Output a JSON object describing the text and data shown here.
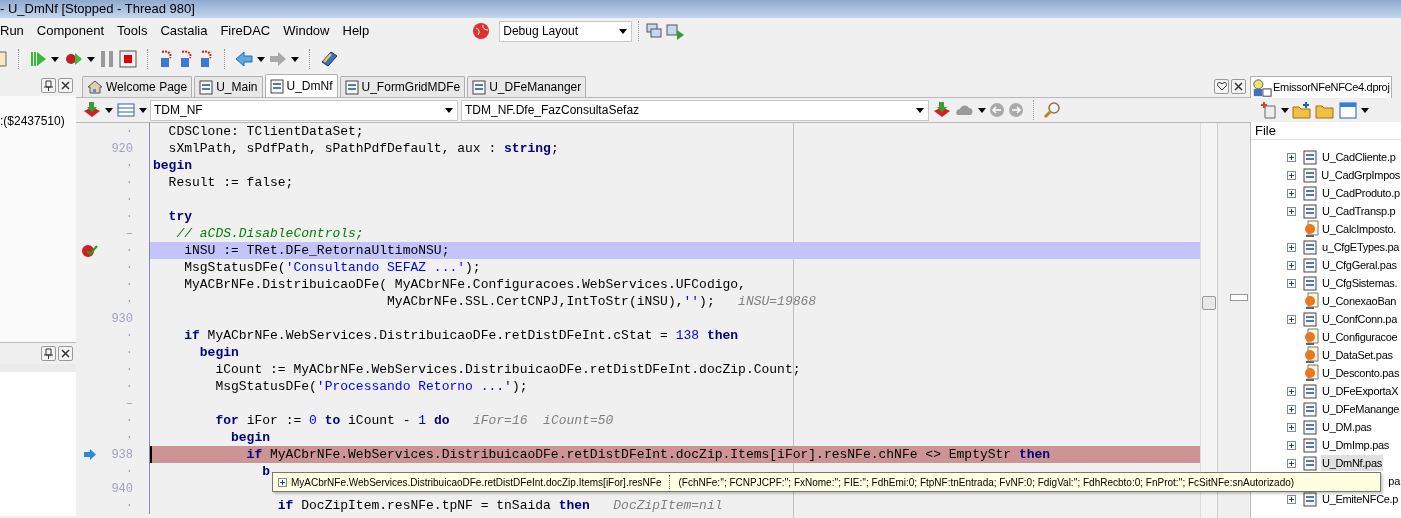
{
  "window": {
    "title": "- U_DmNf [Stopped - Thread 980]"
  },
  "menu": [
    "Run",
    "Component",
    "Tools",
    "Castalia",
    "FireDAC",
    "Window",
    "Help"
  ],
  "layout_combo": {
    "value": "Debug Layout"
  },
  "left_panel": {
    "text": ":($2437510)"
  },
  "editor_tabs": [
    {
      "label": "Welcome Page",
      "kind": "home",
      "selected": false
    },
    {
      "label": "U_Main",
      "kind": "unit",
      "selected": false
    },
    {
      "label": "U_DmNf",
      "kind": "unit",
      "selected": true
    },
    {
      "label": "U_FormGridMDFe",
      "kind": "unit",
      "selected": false
    },
    {
      "label": "U_DFeMananger",
      "kind": "unit",
      "selected": false
    }
  ],
  "unit_combo": {
    "value": "TDM_NF"
  },
  "method_combo": {
    "value": "TDM_NF.Dfe_FazConsultaSefaz"
  },
  "code_lines": [
    {
      "gutter": "·",
      "breakpoint": false,
      "current": false,
      "segments": [
        {
          "kind": "plain",
          "text": "  CDSClone: TClientDataSet;"
        }
      ]
    },
    {
      "gutter": "920",
      "breakpoint": false,
      "current": false,
      "segments": [
        {
          "kind": "plain",
          "text": "  sXmlPath, sPdfPath, sPathPdfDefault, aux : "
        },
        {
          "kind": "keyword",
          "text": "string"
        },
        {
          "kind": "plain",
          "text": ";"
        }
      ]
    },
    {
      "gutter": "·",
      "breakpoint": false,
      "current": false,
      "segments": [
        {
          "kind": "keyword",
          "text": "begin"
        }
      ]
    },
    {
      "gutter": "·",
      "breakpoint": false,
      "current": false,
      "segments": [
        {
          "kind": "plain",
          "text": "  Result := false;"
        }
      ]
    },
    {
      "gutter": "·",
      "breakpoint": false,
      "current": false
    },
    {
      "gutter": "·",
      "breakpoint": false,
      "current": false,
      "segments": [
        {
          "kind": "keyword",
          "text": "  try"
        }
      ]
    },
    {
      "gutter": "–",
      "breakpoint": false,
      "current": false,
      "segments": [
        {
          "kind": "comment",
          "text": "   // aCDS.DisableControls;"
        }
      ]
    },
    {
      "gutter": "·",
      "breakpoint": true,
      "current": false,
      "segments": [
        {
          "kind": "plain",
          "text": "    iNSU := TRet.DFe_RetornaUltimoNSU;"
        }
      ]
    },
    {
      "gutter": "·",
      "breakpoint": false,
      "current": false,
      "segments": [
        {
          "kind": "plain",
          "text": "    MsgStatusDFe("
        },
        {
          "kind": "string",
          "text": "'Consultando SEFAZ ...'"
        },
        {
          "kind": "plain",
          "text": ");"
        }
      ]
    },
    {
      "gutter": "·",
      "breakpoint": false,
      "current": false,
      "segments": [
        {
          "kind": "plain",
          "text": "    MyACBrNFe.DistribuicaoDFe( MyACbrNFe.Configuracoes.WebServices.UFCodigo,"
        }
      ]
    },
    {
      "gutter": "·",
      "breakpoint": false,
      "current": false,
      "segments": [
        {
          "kind": "plain",
          "text": "                              MyACbrNFe.SSL.CertCNPJ,IntToStr(iNSU),"
        },
        {
          "kind": "string",
          "text": "''"
        },
        {
          "kind": "plain",
          "text": ");"
        },
        {
          "kind": "hint",
          "text": "iNSU=19868"
        }
      ]
    },
    {
      "gutter": "930",
      "breakpoint": false,
      "current": false
    },
    {
      "gutter": "·",
      "breakpoint": false,
      "current": false,
      "segments": [
        {
          "kind": "keyword",
          "text": "    if"
        },
        {
          "kind": "plain",
          "text": " MyACbrNFe.WebServices.DistribuicaoDFe.retDistDFeInt.cStat = "
        },
        {
          "kind": "number",
          "text": "138"
        },
        {
          "kind": "keyword",
          "text": " then"
        }
      ]
    },
    {
      "gutter": "·",
      "breakpoint": false,
      "current": false,
      "segments": [
        {
          "kind": "keyword",
          "text": "      begin"
        }
      ]
    },
    {
      "gutter": "·",
      "breakpoint": false,
      "current": false,
      "segments": [
        {
          "kind": "plain",
          "text": "        iCount := MyACbrNFe.WebServices.DistribuicaoDFe.retDistDFeInt.docZip.Count;"
        }
      ]
    },
    {
      "gutter": "·",
      "breakpoint": false,
      "current": false,
      "segments": [
        {
          "kind": "plain",
          "text": "        MsgStatusDFe("
        },
        {
          "kind": "string",
          "text": "'Processando Retorno ...'"
        },
        {
          "kind": "plain",
          "text": ");"
        }
      ]
    },
    {
      "gutter": "–",
      "breakpoint": false,
      "current": false
    },
    {
      "gutter": "·",
      "breakpoint": false,
      "current": false,
      "segments": [
        {
          "kind": "keyword",
          "text": "        for"
        },
        {
          "kind": "plain",
          "text": " iFor := "
        },
        {
          "kind": "number",
          "text": "0"
        },
        {
          "kind": "keyword",
          "text": " to"
        },
        {
          "kind": "plain",
          "text": " iCount - "
        },
        {
          "kind": "number",
          "text": "1"
        },
        {
          "kind": "keyword",
          "text": " do"
        },
        {
          "kind": "hint",
          "text": "iFor=16  iCount=50"
        }
      ]
    },
    {
      "gutter": "·",
      "breakpoint": false,
      "current": false,
      "segments": [
        {
          "kind": "keyword",
          "text": "          begin"
        }
      ]
    },
    {
      "gutter": "938",
      "breakpoint": false,
      "current": true,
      "segments": [
        {
          "kind": "keyword",
          "text": "            if"
        },
        {
          "kind": "plain",
          "text": " MyACbrNFe.WebServices.DistribuicaoDFe.retDistDFeInt.docZip.Items[iFor].resNFe.chNFe <> EmptyStr"
        },
        {
          "kind": "keyword",
          "text": " then"
        }
      ]
    },
    {
      "gutter": "·",
      "breakpoint": false,
      "current": false,
      "segments": [
        {
          "kind": "keyword",
          "text": "              b"
        }
      ]
    },
    {
      "gutter": "940",
      "breakpoint": false,
      "current": false
    },
    {
      "gutter": "·",
      "breakpoint": false,
      "current": false,
      "segments": [
        {
          "kind": "keyword",
          "text": "                if"
        },
        {
          "kind": "plain",
          "text": " DocZipItem.resNFe.tpNF = tnSaida"
        },
        {
          "kind": "keyword",
          "text": " then"
        },
        {
          "kind": "hint",
          "text": "DocZipItem=nil"
        }
      ]
    }
  ],
  "tooltip": {
    "expression": "MyACbrNFe.WebServices.DistribuicaoDFe.retDistDFeInt.docZip.Items[iFor].resNFe",
    "value": "(FchNFe:''; FCNPJCPF:''; FxNome:''; FIE:''; FdhEmi:0; FtpNF:tnEntrada; FvNF:0; FdigVal:''; FdhRecbto:0; FnProt:''; FcSitNFe:snAutorizado)"
  },
  "project_panel": {
    "tab": "EmissorNFeNFCe4.dproj",
    "column": "File",
    "items": [
      {
        "label": "U_CadCliente.p",
        "kind": "form",
        "expander": true,
        "selected": false
      },
      {
        "label": "U_CadGrpImpos",
        "kind": "form",
        "expander": true,
        "selected": false
      },
      {
        "label": "U_CadProduto.p",
        "kind": "form",
        "expander": true,
        "selected": false
      },
      {
        "label": "U_CadTransp.p",
        "kind": "form",
        "expander": true,
        "selected": false
      },
      {
        "label": "U_CalcImposto.",
        "kind": "unit",
        "expander": false,
        "selected": false
      },
      {
        "label": "u_CfgETypes.pa",
        "kind": "form",
        "expander": true,
        "selected": false
      },
      {
        "label": "U_CfgGeral.pas",
        "kind": "form",
        "expander": true,
        "selected": false
      },
      {
        "label": "U_CfgSistemas.",
        "kind": "form",
        "expander": true,
        "selected": false
      },
      {
        "label": "U_ConexaoBan",
        "kind": "unit",
        "expander": false,
        "selected": false
      },
      {
        "label": "U_ConfConn.pa",
        "kind": "form",
        "expander": true,
        "selected": false
      },
      {
        "label": "U_Configuracoe",
        "kind": "unit",
        "expander": false,
        "selected": false
      },
      {
        "label": "U_DataSet.pas",
        "kind": "unit",
        "expander": false,
        "selected": false
      },
      {
        "label": "U_Desconto.pas",
        "kind": "unit",
        "expander": false,
        "selected": false
      },
      {
        "label": "U_DFeExportaX",
        "kind": "form",
        "expander": true,
        "selected": false
      },
      {
        "label": "U_DFeManange",
        "kind": "form",
        "expander": true,
        "selected": false
      },
      {
        "label": "U_DM.pas",
        "kind": "form",
        "expander": true,
        "selected": false
      },
      {
        "label": "U_DmImp.pas",
        "kind": "form",
        "expander": true,
        "selected": false
      },
      {
        "label": "U_DmNf.pas",
        "kind": "form",
        "expander": true,
        "selected": true
      },
      {
        "label": "pa",
        "kind": "covered",
        "expander": false,
        "selected": false
      },
      {
        "label": "U_EmiteNFCe.p",
        "kind": "form",
        "expander": true,
        "selected": false
      }
    ]
  }
}
